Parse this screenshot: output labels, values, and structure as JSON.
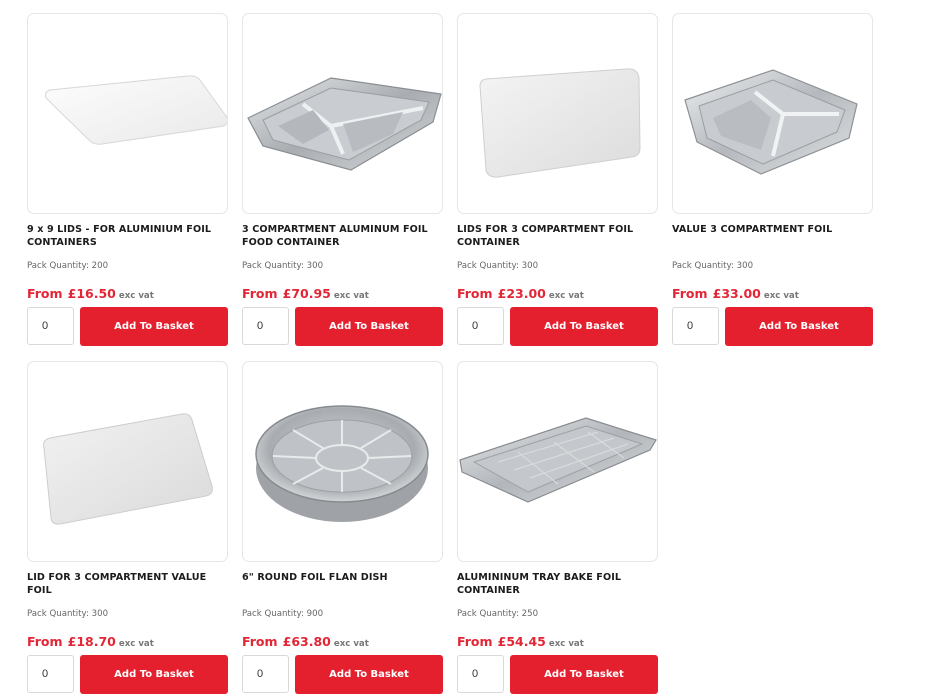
{
  "labels": {
    "from": "From",
    "exc_vat": "exc vat",
    "pack_quantity": "Pack Quantity:",
    "add_to_basket": "Add To Basket"
  },
  "colors": {
    "accent": "#e4202e",
    "price": "#e32636"
  },
  "products": [
    {
      "title": "9 x 9 LIDS - FOR ALUMINIUM FOIL CONTAINERS",
      "pack_quantity": "200",
      "price": "£16.50",
      "qty": "0",
      "image": "square-white-lid"
    },
    {
      "title": "3 COMPARTMENT ALUMINUM FOIL FOOD CONTAINER",
      "pack_quantity": "300",
      "price": "£70.95",
      "qty": "0",
      "image": "foil-3-compartment-tray"
    },
    {
      "title": "LIDS FOR 3 COMPARTMENT FOIL CONTAINER",
      "pack_quantity": "300",
      "price": "£23.00",
      "qty": "0",
      "image": "rect-white-lid"
    },
    {
      "title": "VALUE 3 COMPARTMENT FOIL",
      "pack_quantity": "300",
      "price": "£33.00",
      "qty": "0",
      "image": "foil-3-compartment-value"
    },
    {
      "title": "LID FOR 3 COMPARTMENT VALUE FOIL",
      "pack_quantity": "300",
      "price": "£18.70",
      "qty": "0",
      "image": "rect-white-lid"
    },
    {
      "title": "6\" ROUND FOIL FLAN DISH",
      "pack_quantity": "900",
      "price": "£63.80",
      "qty": "0",
      "image": "round-foil-flan-dish"
    },
    {
      "title": "ALUMININUM TRAY BAKE FOIL CONTAINER",
      "pack_quantity": "250",
      "price": "£54.45",
      "qty": "0",
      "image": "foil-tray-bake"
    }
  ]
}
